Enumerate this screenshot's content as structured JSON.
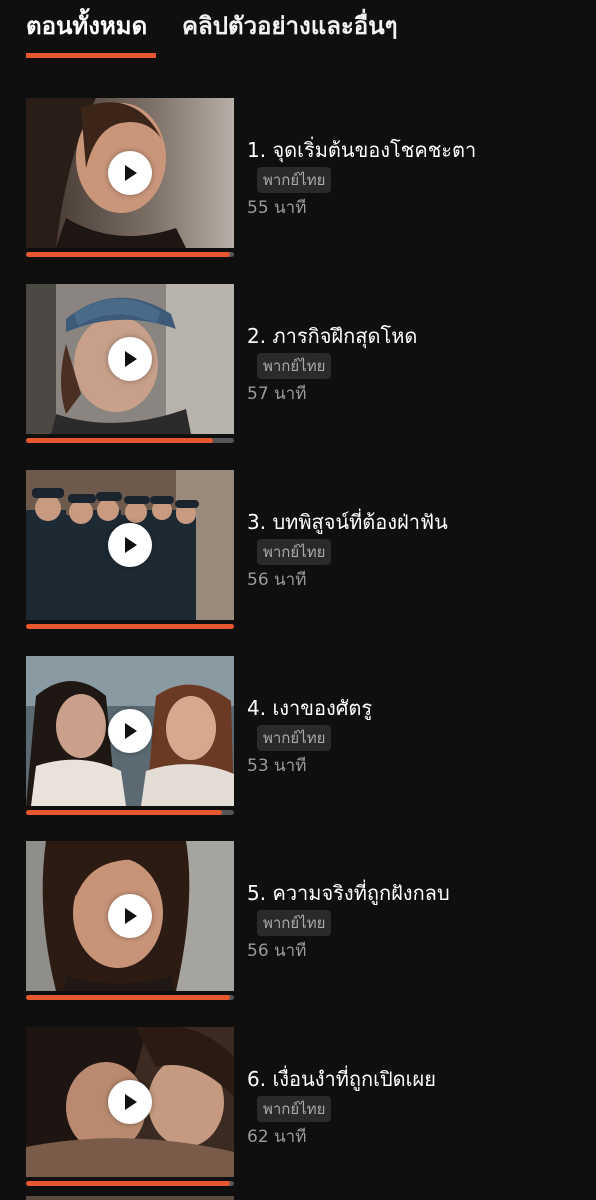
{
  "tabs": {
    "all_episodes": "ตอนทั้งหมด",
    "clips": "คลิปตัวอย่างและอื่นๆ"
  },
  "accent_color": "#e8572f",
  "play_icon": "play-icon",
  "episodes": [
    {
      "title": "1. จุดเริ่มต้นของโชคชะตา",
      "badge": "พากย์ไทย",
      "duration": "55 นาที",
      "progress": 0.98
    },
    {
      "title": "2. ภารกิจฝึกสุดโหด",
      "badge": "พากย์ไทย",
      "duration": "57 นาที",
      "progress": 0.9
    },
    {
      "title": "3. บทพิสูจน์ที่ต้องฝ่าฟัน",
      "badge": "พากย์ไทย",
      "duration": "56 นาที",
      "progress": 1.0
    },
    {
      "title": "4. เงาของศัตรู",
      "badge": "พากย์ไทย",
      "duration": "53 นาที",
      "progress": 0.94
    },
    {
      "title": "5. ความจริงที่ถูกฝังกลบ",
      "badge": "พากย์ไทย",
      "duration": "56 นาที",
      "progress": 0.98
    },
    {
      "title": "6. เงื่อนงำที่ถูกเปิดเผย",
      "badge": "พากย์ไทย",
      "duration": "62 นาที",
      "progress": 0.98
    }
  ]
}
